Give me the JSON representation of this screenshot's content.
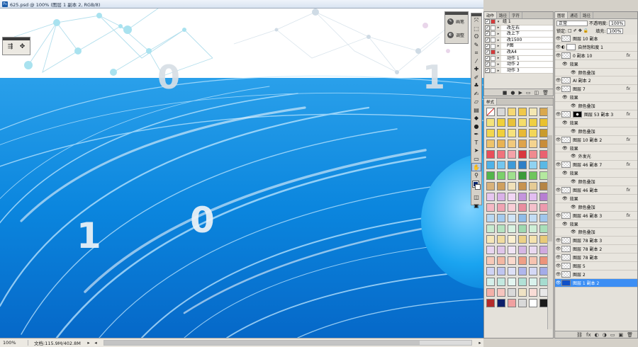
{
  "document": {
    "title": "625.psd @ 100% (图层 1 副本 2, RGB/8)",
    "digits": [
      "0",
      "1",
      "1",
      "0"
    ]
  },
  "status_bar": {
    "zoom": "100%",
    "doc_size": "文档:115.9M/402.8M"
  },
  "panel_strip": {
    "items": [
      {
        "label": "画笔",
        "icon": "brush-icon"
      },
      {
        "label": "调整",
        "icon": "adjust-icon"
      }
    ]
  },
  "tools": [
    {
      "name": "move-tool-icon",
      "glyph": "⤧"
    },
    {
      "name": "marquee-tool-icon",
      "glyph": "⬚"
    },
    {
      "name": "lasso-tool-icon",
      "glyph": "ʘ"
    },
    {
      "name": "quick-select-tool-icon",
      "glyph": "✎"
    },
    {
      "name": "crop-tool-icon",
      "glyph": "⌗"
    },
    {
      "name": "eyedropper-tool-icon",
      "glyph": "⁄"
    },
    {
      "name": "healing-tool-icon",
      "glyph": "✚"
    },
    {
      "name": "brush-tool-icon",
      "glyph": "✐"
    },
    {
      "name": "stamp-tool-icon",
      "glyph": "♣"
    },
    {
      "name": "history-brush-tool-icon",
      "glyph": "✍"
    },
    {
      "name": "eraser-tool-icon",
      "glyph": "▱"
    },
    {
      "name": "gradient-tool-icon",
      "glyph": "▤"
    },
    {
      "name": "blur-tool-icon",
      "glyph": "◆"
    },
    {
      "name": "dodge-tool-icon",
      "glyph": "●"
    },
    {
      "name": "pen-tool-icon",
      "glyph": "✒"
    },
    {
      "name": "type-tool-icon",
      "glyph": "T"
    },
    {
      "name": "path-select-tool-icon",
      "glyph": "➤"
    },
    {
      "name": "shape-tool-icon",
      "glyph": "▭"
    },
    {
      "name": "hand-tool-icon",
      "glyph": "✋"
    },
    {
      "name": "zoom-tool-icon",
      "glyph": "⚲"
    }
  ],
  "actions_panel": {
    "tabs": [
      "动作",
      "路径",
      "字符"
    ],
    "rows": [
      {
        "label": "组 1",
        "checked": true,
        "red": true,
        "group": true
      },
      {
        "label": "改左右",
        "checked": true,
        "red": false,
        "group": false
      },
      {
        "label": "改上下",
        "checked": true,
        "red": false,
        "group": false
      },
      {
        "label": "改1500",
        "checked": true,
        "red": false,
        "group": false
      },
      {
        "label": "P图",
        "checked": true,
        "red": false,
        "group": false
      },
      {
        "label": "改A4",
        "checked": true,
        "red": true,
        "group": false
      },
      {
        "label": "动作 1",
        "checked": true,
        "red": false,
        "group": false
      },
      {
        "label": "动作 2",
        "checked": true,
        "red": false,
        "group": false
      },
      {
        "label": "动作 3",
        "checked": true,
        "red": false,
        "group": false
      }
    ],
    "footer": [
      "■",
      "●",
      "▶",
      "▭",
      "◫",
      "🗑"
    ]
  },
  "styles_panel": {
    "tab": "样式",
    "swatches": [
      "#ffffff",
      "#d8d8d8",
      "#f6d873",
      "#f0c84a",
      "#f3e7b2",
      "#d9a84e",
      "#f4e37a",
      "#f0d03a",
      "#e8c23a",
      "#f5dd6b",
      "#efcf43",
      "#e9c12f",
      "#f2d64d",
      "#f0cf3a",
      "#f6e27d",
      "#e8b935",
      "#f3d658",
      "#c99b2c",
      "#eec36b",
      "#e8b253",
      "#f1c97c",
      "#dea34b",
      "#f4d38f",
      "#c88d3a",
      "#e94f5a",
      "#f0737c",
      "#f4a2a8",
      "#d9383f",
      "#f08a8f",
      "#ea6270",
      "#4fb2e8",
      "#74c6ef",
      "#3f9bd9",
      "#2f7fc7",
      "#8fd2f1",
      "#5ab8e5",
      "#53b54a",
      "#7bd06b",
      "#9fe08d",
      "#3c9b38",
      "#6fc55d",
      "#b4e89f",
      "#d9b27a",
      "#cfa05e",
      "#f0e0b8",
      "#c79350",
      "#e5cb95",
      "#b58444",
      "#e6c6ef",
      "#d9b1e8",
      "#f1d6f4",
      "#c495dd",
      "#e2bdf0",
      "#b77fd2",
      "#f5b8c4",
      "#f0a3b2",
      "#f8cdd6",
      "#e98ea0",
      "#f4c0cb",
      "#ed9aae",
      "#b9d8f2",
      "#a4cbee",
      "#cfe4f6",
      "#8fbde9",
      "#c2dcf4",
      "#9fc6ec",
      "#c8ebd0",
      "#b5e3c0",
      "#d9f2e0",
      "#9fd9b0",
      "#cdeed6",
      "#a9dfb9",
      "#f6e7b8",
      "#f1dc9f",
      "#fbf0cf",
      "#ecd186",
      "#f5e3ad",
      "#e8ca78",
      "#e9d6f0",
      "#dfc5ea",
      "#f1e4f5",
      "#d5b6e4",
      "#ead9f1",
      "#cfa9df",
      "#f7c9b8",
      "#f3b7a2",
      "#fad9cd",
      "#ef9f86",
      "#f6c3b0",
      "#eb937a",
      "#cfd3f4",
      "#bfc5f0",
      "#dde0f7",
      "#afb6ec",
      "#d4d8f5",
      "#a3abe8",
      "#d5f0ea",
      "#c3e9e0",
      "#e3f6f1",
      "#b1e1d6",
      "#d9f2ec",
      "#a5dccf",
      "#f3b0a8",
      "#f6c5bf",
      "#d9d9d9",
      "#efe2c4",
      "#f9dcd6",
      "#e8e8e8",
      "#b52b2b",
      "#0c1f6b",
      "#f0a0a0",
      "#d9d9d9",
      "#ffffff",
      "#1a1a1a"
    ]
  },
  "layers_panel": {
    "tabs": [
      "图层",
      "通道",
      "路径"
    ],
    "blend_mode": "正常",
    "opacity_label": "不透明度:",
    "opacity_value": "100%",
    "lock_label": "锁定:",
    "fill_label": "填充:",
    "fill_value": "100%",
    "rows": [
      {
        "label": "图层 10 副本",
        "kind": "layer",
        "fx": false,
        "thumb": "checker"
      },
      {
        "label": "自然饱和度 1",
        "kind": "adjust",
        "fx": false,
        "thumb": "white"
      },
      {
        "label": "0 副本 10",
        "kind": "layer",
        "fx": true,
        "thumb": "checker"
      },
      {
        "label": "效果",
        "kind": "sub",
        "fx": false
      },
      {
        "label": "颜色叠加",
        "kind": "sub2",
        "fx": false
      },
      {
        "label": "AI 副本 2",
        "kind": "layer",
        "fx": false,
        "thumb": "checker"
      },
      {
        "label": "图层 7",
        "kind": "layer",
        "fx": true,
        "thumb": "checker"
      },
      {
        "label": "效果",
        "kind": "sub",
        "fx": false
      },
      {
        "label": "颜色叠加",
        "kind": "sub2",
        "fx": false
      },
      {
        "label": "图层 53 副本 3",
        "kind": "layer",
        "fx": true,
        "thumb": "checker",
        "mask": true
      },
      {
        "label": "效果",
        "kind": "sub",
        "fx": false
      },
      {
        "label": "颜色叠加",
        "kind": "sub2",
        "fx": false
      },
      {
        "label": "图层 10 副本 2",
        "kind": "layer",
        "fx": true,
        "thumb": "checker"
      },
      {
        "label": "效果",
        "kind": "sub",
        "fx": false
      },
      {
        "label": "外发光",
        "kind": "sub2",
        "fx": false
      },
      {
        "label": "图层 46 副本 7",
        "kind": "layer",
        "fx": true,
        "thumb": "checker"
      },
      {
        "label": "效果",
        "kind": "sub",
        "fx": false
      },
      {
        "label": "颜色叠加",
        "kind": "sub2",
        "fx": false
      },
      {
        "label": "图层 46 副本",
        "kind": "layer",
        "fx": true,
        "thumb": "checker"
      },
      {
        "label": "效果",
        "kind": "sub",
        "fx": false
      },
      {
        "label": "颜色叠加",
        "kind": "sub2",
        "fx": false
      },
      {
        "label": "图层 46 副本 3",
        "kind": "layer",
        "fx": true,
        "thumb": "checker"
      },
      {
        "label": "效果",
        "kind": "sub",
        "fx": false
      },
      {
        "label": "颜色叠加",
        "kind": "sub2",
        "fx": false
      },
      {
        "label": "图层 78 副本 3",
        "kind": "layer",
        "fx": false,
        "thumb": "checker"
      },
      {
        "label": "图层 78 副本 2",
        "kind": "layer",
        "fx": false,
        "thumb": "checker"
      },
      {
        "label": "图层 78 副本",
        "kind": "layer",
        "fx": false,
        "thumb": "checker"
      },
      {
        "label": "图层 5",
        "kind": "layer",
        "fx": false,
        "thumb": "checker"
      },
      {
        "label": "图层 2",
        "kind": "layer",
        "fx": false,
        "thumb": "checker"
      },
      {
        "label": "图层 1 副本 2",
        "kind": "layer",
        "fx": false,
        "thumb": "blue",
        "selected": true
      }
    ],
    "footer": [
      "⛓",
      "fx",
      "◐",
      "◑",
      "▭",
      "▣",
      "🗑"
    ]
  },
  "colors": {
    "accent": "#3c8ef4",
    "foreground": "#03226a",
    "background": "#ffffff"
  }
}
